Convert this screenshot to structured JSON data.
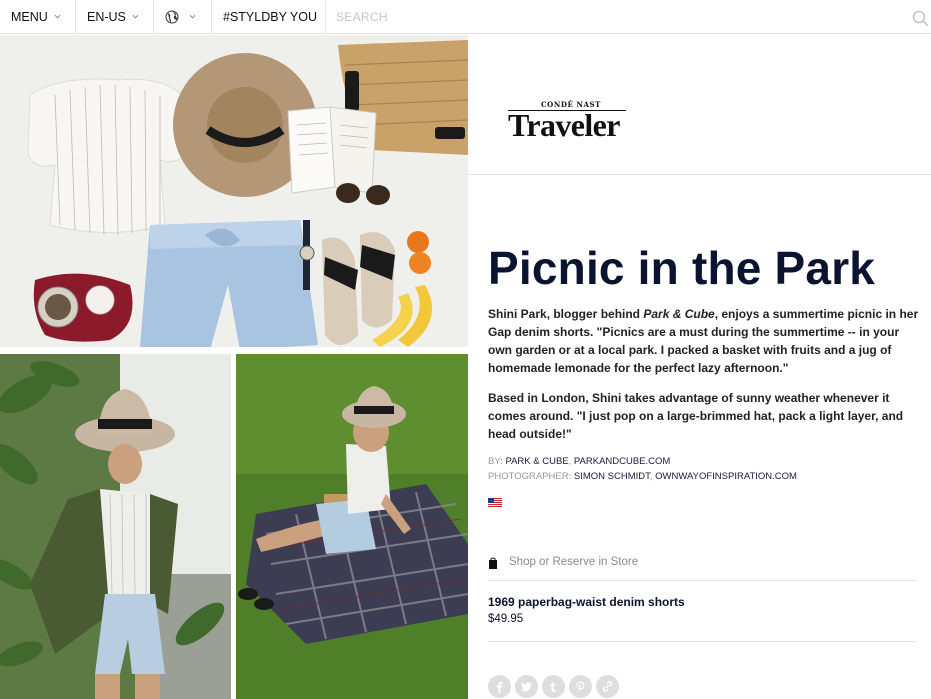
{
  "nav": {
    "menu_label": "MENU",
    "language_label": "EN-US",
    "styld_label": "#STYLDBY YOU",
    "search_placeholder": "SEARCH",
    "icons": {
      "globe": "globe-icon",
      "chevron": "chevron-down-icon",
      "search": "search-icon"
    }
  },
  "photos": {
    "items": [
      "flat-lay-outfit",
      "standing-portrait",
      "picnic-blanket"
    ]
  },
  "brand": {
    "logo_top": "CONDÉ NAST",
    "logo_main": "Traveler"
  },
  "article": {
    "title": "Picnic in the Park",
    "para1_before": "Shini Park, blogger behind ",
    "para1_italic": "Park & Cube",
    "para1_after": ", enjoys a summertime picnic in her Gap denim shorts. \"Picnics are a must during the summertime -- in your own garden or at a local park. I packed a basket with fruits and a jug of homemade lemonade for the perfect lazy afternoon.\"",
    "para2": "Based in London, Shini takes advantage of sunny weather whenever it comes around. \"I just pop on a large-brimmed hat, pack a light layer, and head outside!\""
  },
  "credits": {
    "by_label": "BY:",
    "by_name": "PARK & CUBE",
    "by_site": "PARKANDCUBE.COM",
    "photographer_label": "PHOTOGRAPHER:",
    "photographer_name": "SIMON SCHMIDT",
    "photographer_site": "OWNWAYOFINSPIRATION.COM",
    "flag_icon": "us-flag-icon"
  },
  "shop": {
    "label": "Shop or Reserve in Store",
    "icon": "shopping-bag-icon"
  },
  "product": {
    "name": "1969 paperbag-waist denim shorts",
    "price": "$49.95"
  },
  "share": {
    "icons": [
      "facebook-icon",
      "twitter-icon",
      "tumblr-icon",
      "pinterest-icon",
      "link-icon"
    ],
    "color": "#dedede"
  },
  "colors": {
    "title": "#0a1330",
    "border": "#e3e3e3",
    "muted": "#999999"
  }
}
